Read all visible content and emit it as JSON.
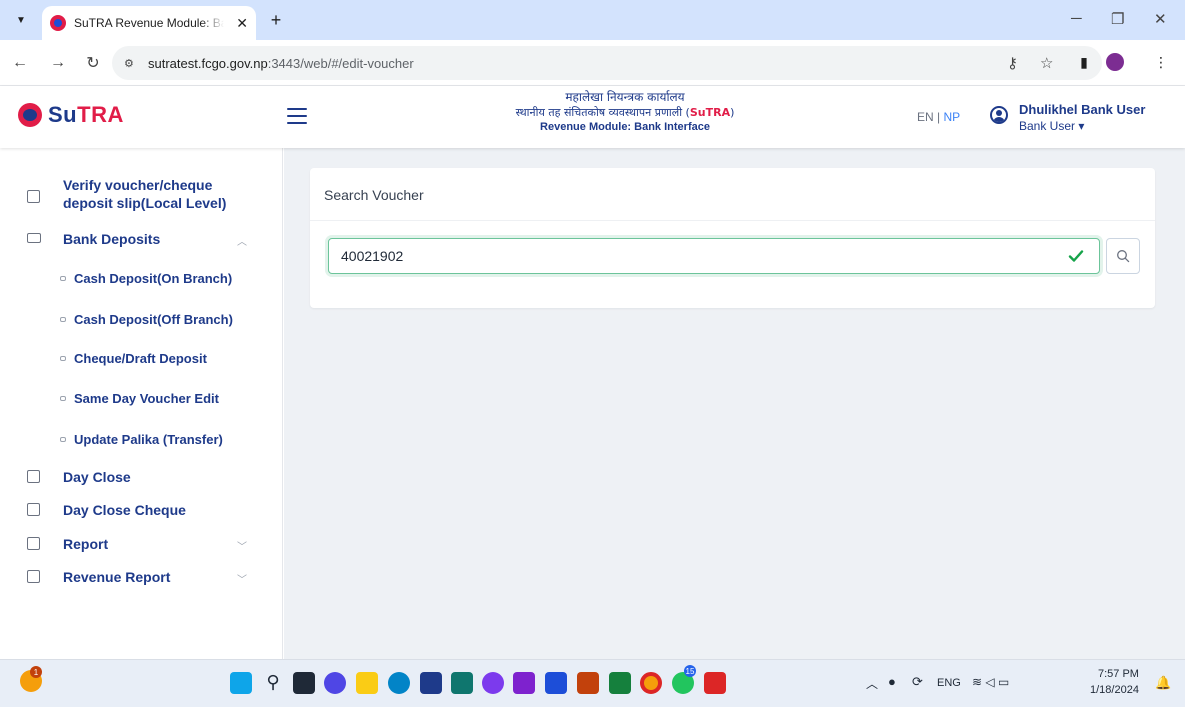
{
  "browser": {
    "tab_title": "SuTRA Revenue Module: Bank I",
    "url_host": "sutratest.fcgo.gov.np",
    "url_path": ":3443/web/#/edit-voucher"
  },
  "header": {
    "logo_prefix": "Su",
    "logo_suffix": "TRA",
    "line1": "महालेखा नियन्त्रक कार्यालय",
    "line2_prefix": "स्थानीय तह संचितकोष व्यवस्थापन प्रणाली (",
    "line2_brand": "SuTRA",
    "line2_suffix": ")",
    "line3": "Revenue Module: Bank Interface",
    "lang_en": "EN",
    "lang_sep": " | ",
    "lang_np": "NP",
    "user_name": "Dhulikhel Bank User",
    "user_role": "Bank User ▾"
  },
  "sidebar": {
    "verify_line1": "Verify voucher/cheque",
    "verify_line2": "deposit slip(Local Level)",
    "bank_deposits": "Bank Deposits",
    "sub_items": [
      "Cash Deposit(On Branch)",
      "Cash Deposit(Off Branch)",
      "Cheque/Draft Deposit",
      "Same Day Voucher Edit",
      "Update Palika (Transfer)"
    ],
    "day_close": "Day Close",
    "day_close_cheque": "Day Close Cheque",
    "report": "Report",
    "revenue_report": "Revenue Report"
  },
  "main": {
    "card_title": "Search Voucher",
    "search_value": "40021902"
  },
  "taskbar": {
    "lang": "ENG",
    "time": "7:57 PM",
    "date": "1/18/2024",
    "chrome_badge": "15"
  },
  "colors": {
    "brand_blue": "#1e3a8a",
    "brand_red": "#e11d48",
    "valid_green": "#6cc49a"
  }
}
